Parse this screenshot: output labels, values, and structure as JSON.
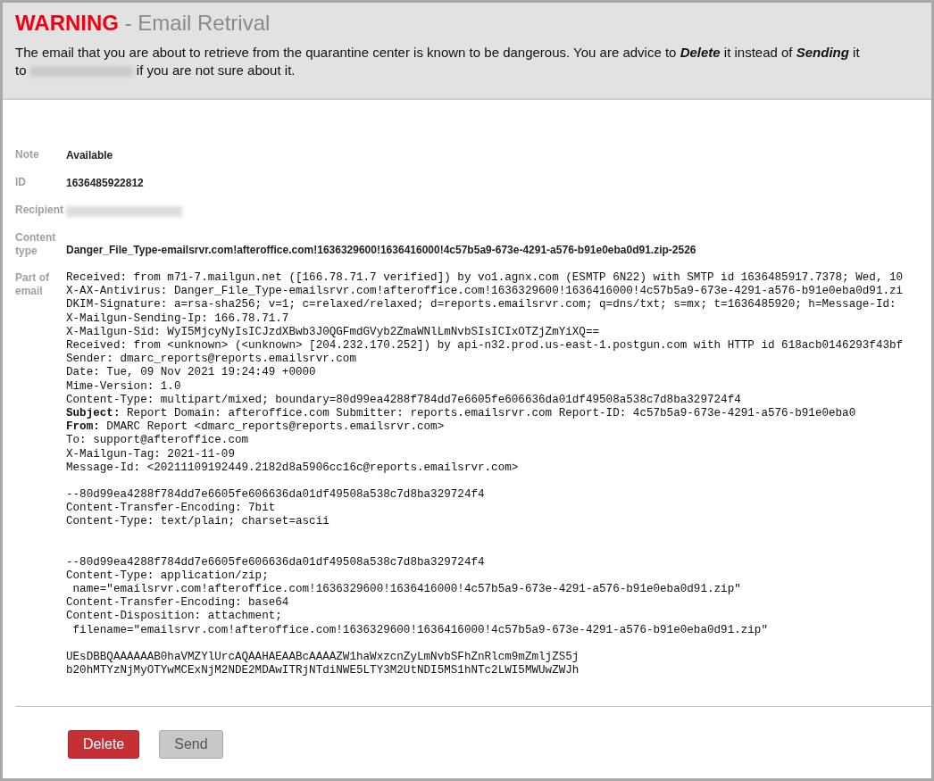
{
  "header": {
    "title": "WARNING",
    "subtitle": " - Email Retrival",
    "message_before": "The email that you are about to retrieve from the quarantine center is known to be dangerous. You are advice to **Delete** it instead of **Sending** it to",
    "message_after": "if you are not sure about it.",
    "recipient_redacted": true
  },
  "fields": [
    {
      "label": "Note",
      "kind": "text",
      "value": "Available"
    },
    {
      "label": "ID",
      "kind": "text",
      "value": "1636485922812"
    },
    {
      "label": "Recipient",
      "kind": "redacted"
    },
    {
      "label": "Content type",
      "kind": "text",
      "value": "Danger_File_Type-emailsrvr.com!afteroffice.com!1636329600!1636416000!4c57b5a9-673e-4291-a576-b91e0eba0d91.zip-2526"
    },
    {
      "label": "Part of email",
      "kind": "source",
      "blocks": [
        {
          "kind": "headers",
          "lines": [
            "Received: from m71-7.mailgun.net ([166.78.71.7 verified]) by vo1.agnx.com (ESMTP 6N22) with SMTP id 1636485917.7378; Wed, 10",
            "X-AX-Antivirus: Danger_File_Type-emailsrvr.com!afteroffice.com!1636329600!1636416000!4c57b5a9-673e-4291-a576-b91e0eba0d91.zi",
            "DKIM-Signature: a=rsa-sha256; v=1; c=relaxed/relaxed; d=reports.emailsrvr.com; q=dns/txt; s=mx; t=1636485920; h=Message-Id:",
            "X-Mailgun-Sending-Ip: 166.78.71.7",
            "X-Mailgun-Sid: WyI5MjcyNyIsICJzdXBwb3J0QGFmdGVyb2ZmaWNlLmNvbSIsICIxOTZjZmYiXQ==",
            "Received: from <unknown> (<unknown> [204.232.170.252]) by api-n32.prod.us-east-1.postgun.com with HTTP id 618acb0146293f43bf",
            "Sender: dmarc_reports@reports.emailsrvr.com",
            "Date: Tue, 09 Nov 2021 19:24:49 +0000",
            "Mime-Version: 1.0",
            "Content-Type: multipart/mixed; boundary=80d99ea4288f784dd7e6605fe606636da01df49508a538c7d8ba329724f4",
            "**Subject:** Report Domain: afteroffice.com Submitter: reports.emailsrvr.com Report-ID: 4c57b5a9-673e-4291-a576-b91e0eba0",
            "**From:** DMARC Report <dmarc_reports@reports.emailsrvr.com>",
            "To: support@afteroffice.com",
            "X-Mailgun-Tag: 2021-11-09",
            "Message-Id: <20211109192449.2182d8a5906cc16c@reports.emailsrvr.com>"
          ]
        },
        {
          "kind": "part",
          "lines": [
            "--80d99ea4288f784dd7e6605fe606636da01df49508a538c7d8ba329724f4",
            "Content-Transfer-Encoding: 7bit",
            "Content-Type: text/plain; charset=ascii"
          ]
        },
        {
          "kind": "attachment",
          "lines": [
            "--80d99ea4288f784dd7e6605fe606636da01df49508a538c7d8ba329724f4",
            "Content-Type: application/zip;",
            " name=\"emailsrvr.com!afteroffice.com!1636329600!1636416000!4c57b5a9-673e-4291-a576-b91e0eba0d91.zip\"",
            "Content-Transfer-Encoding: base64",
            "Content-Disposition: attachment;",
            " filename=\"emailsrvr.com!afteroffice.com!1636329600!1636416000!4c57b5a9-673e-4291-a576-b91e0eba0d91.zip\""
          ]
        },
        {
          "kind": "data",
          "lines": [
            "UEsDBBQAAAAAAB0haVMZYlUrcAQAAHAEAABcAAAAZW1haWxzcnZyLmNvbSFhZnRlcm9mZmljZS5j",
            "b20hMTYzNjMyOTYwMCExNjM2NDE2MDAwITRjNTdiNWE5LTY3M2UtNDI5MS1hNTc2LWI5MWUwZWJh"
          ]
        }
      ]
    }
  ],
  "buttons": [
    {
      "label": "Delete",
      "kind": "danger"
    },
    {
      "label": "Send",
      "kind": "default"
    }
  ]
}
